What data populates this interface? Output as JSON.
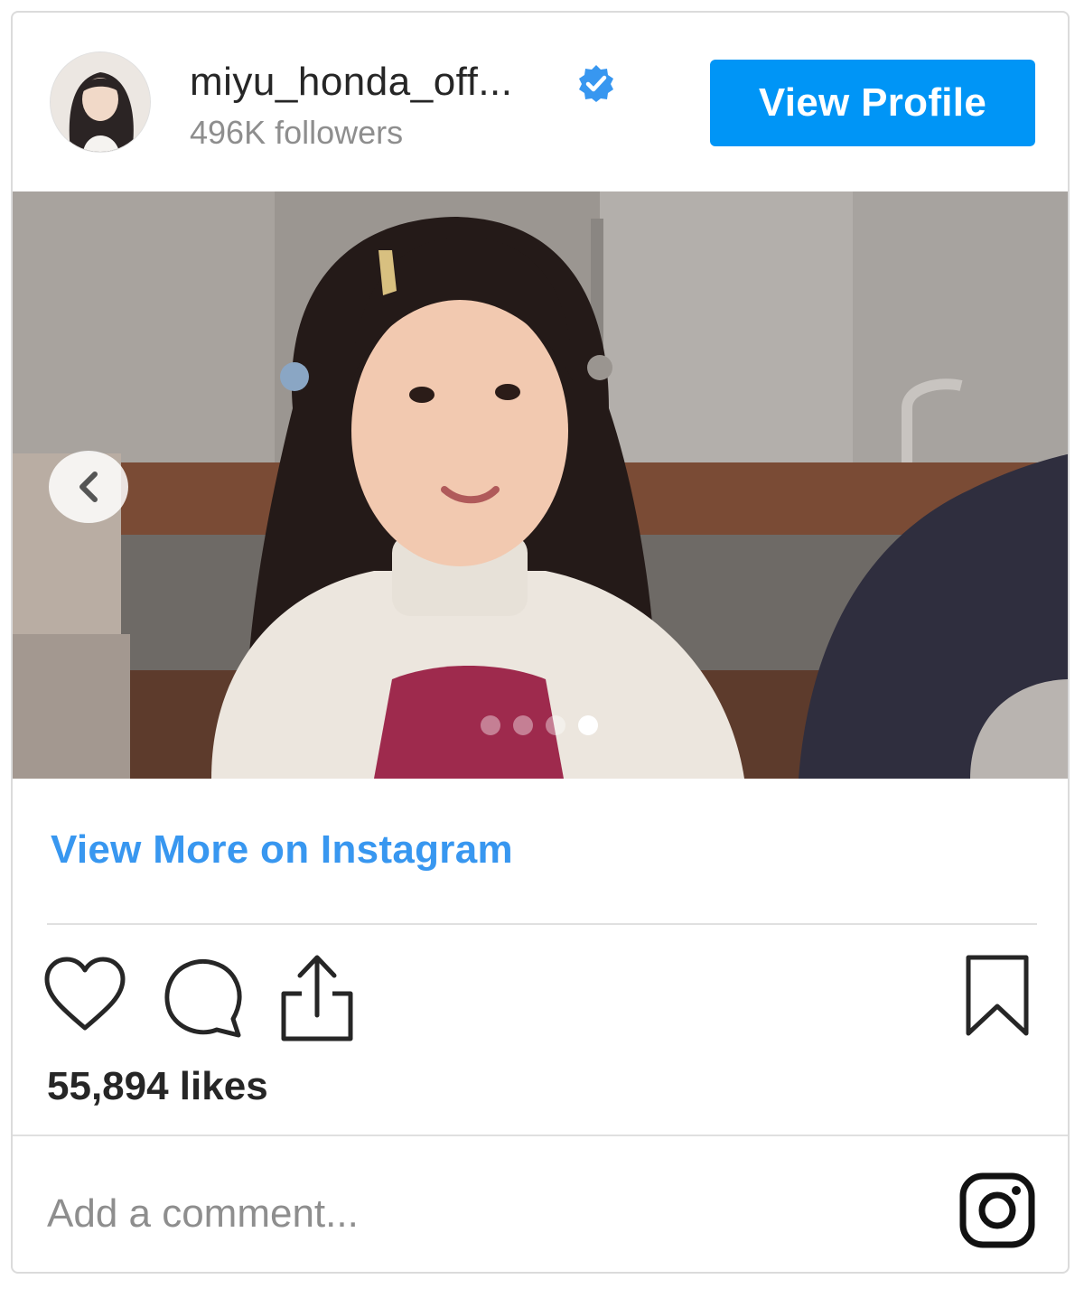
{
  "header": {
    "username": "miyu_honda_off...",
    "followers": "496K followers",
    "view_profile_label": "View Profile"
  },
  "carousel": {
    "slide_count": 4,
    "active_index": 3
  },
  "view_more_label": "View More on Instagram",
  "likes": "55,894 likes",
  "comment": {
    "placeholder": "Add a comment...",
    "value": ""
  },
  "icons": {
    "verified": "verified-badge-icon",
    "prev": "chevron-left-icon",
    "like": "heart-icon",
    "comment": "comment-bubble-icon",
    "share": "share-icon",
    "save": "bookmark-icon",
    "brand": "instagram-logo-icon"
  },
  "colors": {
    "accent": "#0095f6",
    "link": "#3897f0",
    "text": "#262626",
    "muted": "#8e8e8e"
  }
}
